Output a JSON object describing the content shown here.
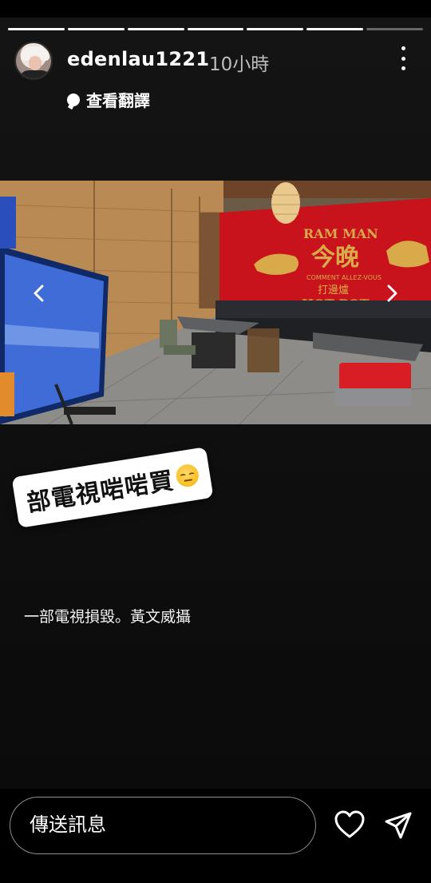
{
  "story": {
    "progress_segments": 7,
    "progress_done": 6,
    "username": "edenlau1221",
    "time": "10小時",
    "translate_label": "查看翻譯",
    "sticker_text": "部電視啱啱買",
    "sticker_emoji": "pensive-face-emoji",
    "caption": "一部電視損毀。黃文威攝"
  },
  "photo": {
    "sign_line1": "RAM MAN",
    "sign_line2": "今晚",
    "sign_line3": "COMMENT ALLEZ-VOUS",
    "sign_line4": "打邊爐",
    "sign_line5": "HOT POT"
  },
  "reply": {
    "placeholder": "傳送訊息"
  },
  "colors": {
    "background": "#000000",
    "wall_red": "#c8121c",
    "gold": "#d8aa4a"
  },
  "icons": [
    "more-options-icon",
    "translate-icon",
    "chevron-left-icon",
    "chevron-right-icon",
    "heart-icon",
    "send-icon"
  ]
}
